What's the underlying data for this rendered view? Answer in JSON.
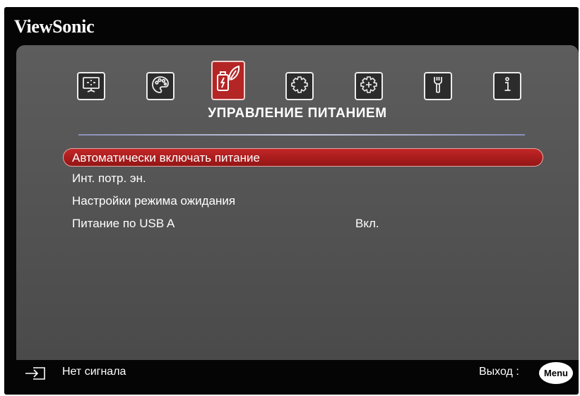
{
  "brand": "ViewSonic",
  "tabs": [
    {
      "name": "display",
      "icon": "display-icon",
      "selected": false
    },
    {
      "name": "image",
      "icon": "palette-icon",
      "selected": false
    },
    {
      "name": "power",
      "icon": "power-management-icon",
      "selected": true
    },
    {
      "name": "basic",
      "icon": "gear-icon",
      "selected": false
    },
    {
      "name": "advanced",
      "icon": "advanced-gear-icon",
      "selected": false
    },
    {
      "name": "system",
      "icon": "wrench-icon",
      "selected": false
    },
    {
      "name": "information",
      "icon": "info-icon",
      "selected": false
    }
  ],
  "menu_title": "УПРАВЛЕНИЕ ПИТАНИЕМ",
  "items": [
    {
      "label": "Автоматически включать питание",
      "value": "",
      "selected": true
    },
    {
      "label": "Инт. потр. эн.",
      "value": "",
      "selected": false
    },
    {
      "label": "Настройки режима ожидания",
      "value": "",
      "selected": false
    },
    {
      "label": "Питание по USB A",
      "value": "Вкл.",
      "selected": false
    }
  ],
  "footer": {
    "source_icon": "input-source-icon",
    "status": "Нет сигнала",
    "exit_label": "Выход :",
    "menu_button": "Menu"
  },
  "colors": {
    "accent": "#b42525",
    "panel": "#555555",
    "text": "#ffffff"
  }
}
